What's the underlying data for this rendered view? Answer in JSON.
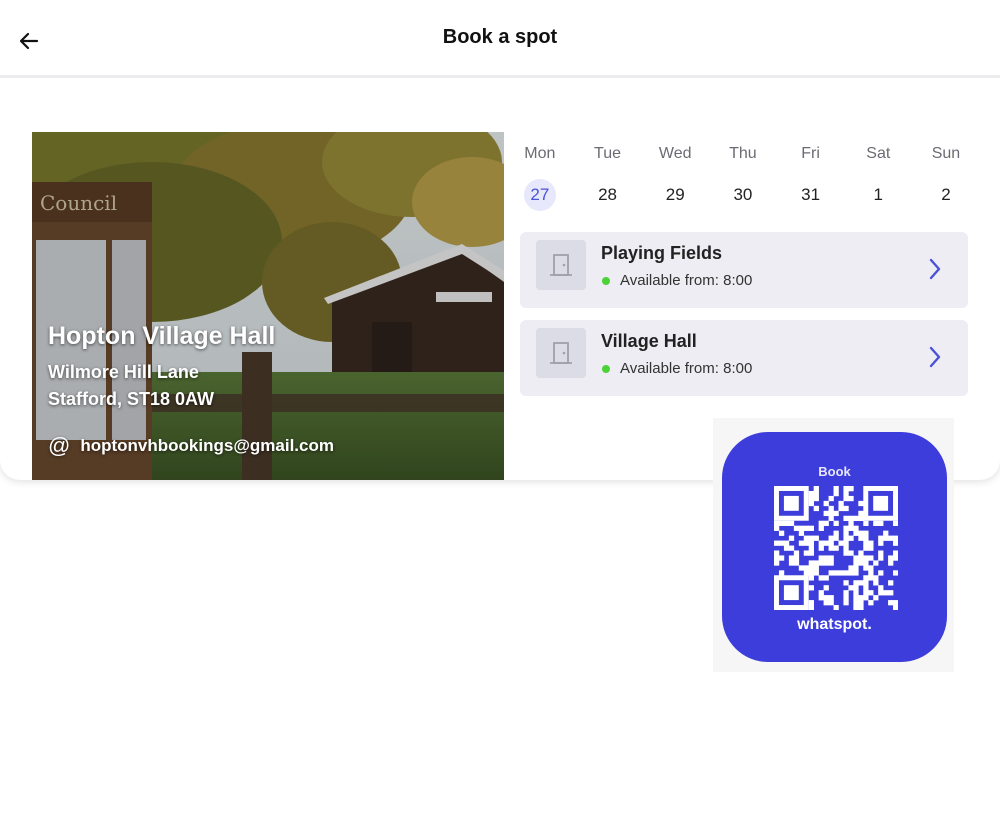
{
  "header": {
    "title": "Book a spot",
    "back_icon": "arrow-left-icon"
  },
  "venue": {
    "name": "Hopton Village Hall",
    "address_line1": "Wilmore Hill Lane",
    "address_line2": "Stafford, ST18 0AW",
    "email_icon": "@",
    "email": "hoptonvhbookings@gmail.com",
    "photo_sign_text": "Council",
    "photo_building_sign": "Hopton Village Hall"
  },
  "calendar": {
    "days": [
      {
        "name": "Mon",
        "date": "27",
        "selected": true
      },
      {
        "name": "Tue",
        "date": "28"
      },
      {
        "name": "Wed",
        "date": "29"
      },
      {
        "name": "Thu",
        "date": "30"
      },
      {
        "name": "Fri",
        "date": "31"
      },
      {
        "name": "Sat",
        "date": "1"
      },
      {
        "name": "Sun",
        "date": "2"
      }
    ],
    "accent_color": "#4b52d6"
  },
  "spaces": [
    {
      "name": "Playing Fields",
      "status": "Available from: 8:00"
    },
    {
      "name": "Village Hall",
      "status": "Available from: 8:00"
    }
  ],
  "qr_badge": {
    "label": "Book",
    "brand": "whatspot.",
    "color": "#3d3ddb"
  }
}
